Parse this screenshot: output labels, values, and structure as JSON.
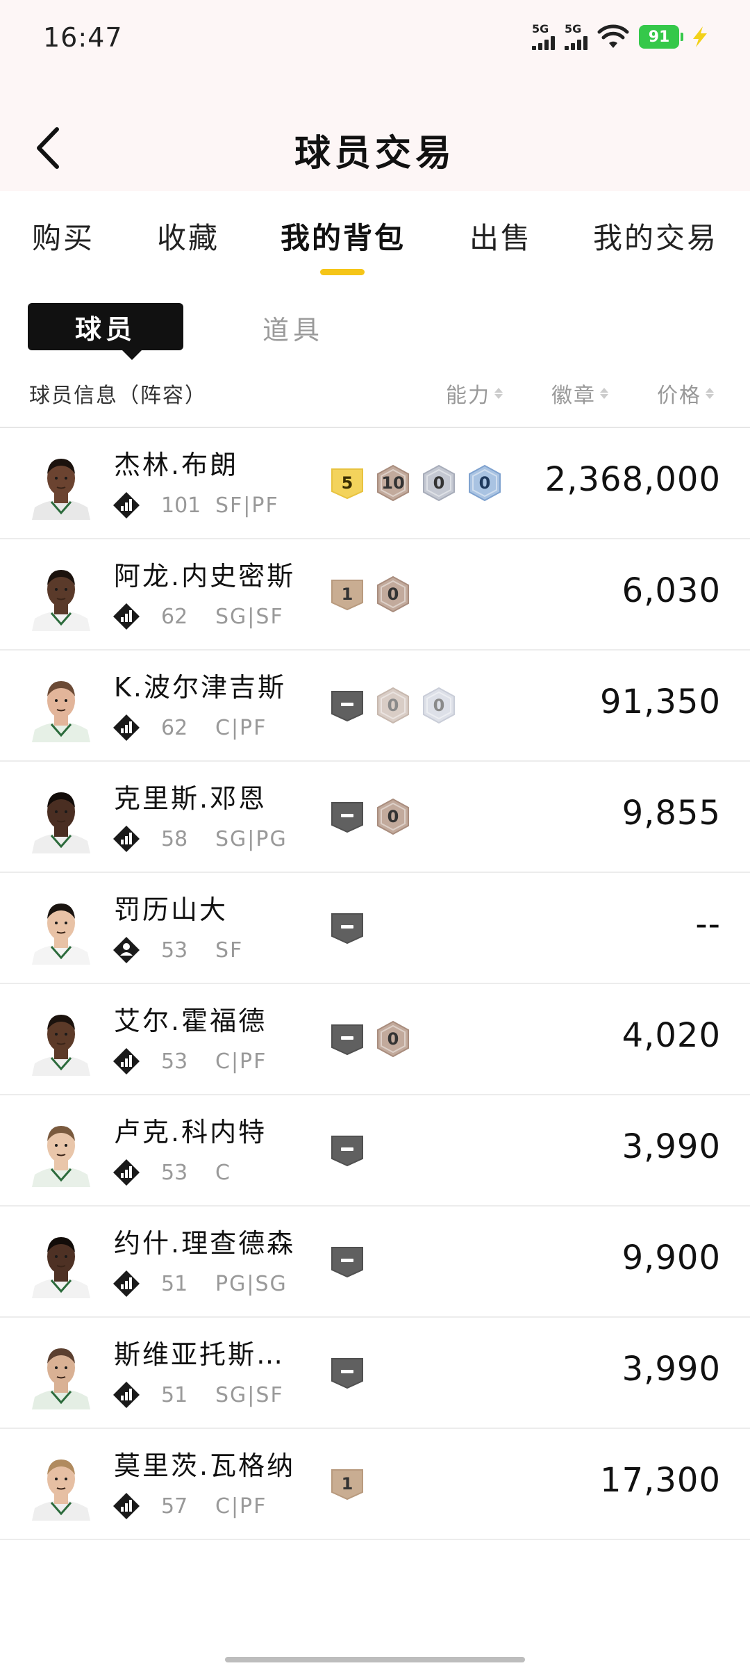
{
  "status_bar": {
    "time": "16:47",
    "signal1": "5G",
    "signal2": "5G",
    "battery": "91"
  },
  "header": {
    "title": "球员交易"
  },
  "tabs": [
    {
      "label": "购买",
      "active": false
    },
    {
      "label": "收藏",
      "active": false
    },
    {
      "label": "我的背包",
      "active": true
    },
    {
      "label": "出售",
      "active": false
    },
    {
      "label": "我的交易",
      "active": false
    }
  ],
  "subtabs": {
    "active": "球员",
    "other": "道具"
  },
  "columns": {
    "info": "球员信息（阵容）",
    "ability": "能力",
    "badge": "徽章",
    "price": "价格"
  },
  "players": [
    {
      "name": "杰林.布朗",
      "rating": "101",
      "position": "SF|PF",
      "price": "2,368,000",
      "rank_icon": "bar-chart-diamond-icon",
      "badges": [
        {
          "type": "gold",
          "value": "5"
        },
        {
          "type": "bronze",
          "value": "10"
        },
        {
          "type": "silver",
          "value": "0"
        },
        {
          "type": "blue",
          "value": "0"
        }
      ]
    },
    {
      "name": "阿龙.内史密斯",
      "rating": "62",
      "position": "SG|SF",
      "price": "6,030",
      "rank_icon": "bar-chart-diamond-icon",
      "badges": [
        {
          "type": "tan",
          "value": "1"
        },
        {
          "type": "bronze",
          "value": "0"
        }
      ]
    },
    {
      "name": "K.波尔津吉斯",
      "rating": "62",
      "position": "C|PF",
      "price": "91,350",
      "rank_icon": "bar-chart-diamond-icon",
      "badges": [
        {
          "type": "dash",
          "value": ""
        },
        {
          "type": "bronze-faded",
          "value": "0"
        },
        {
          "type": "silver-faded",
          "value": "0"
        }
      ]
    },
    {
      "name": "克里斯.邓恩",
      "rating": "58",
      "position": "SG|PG",
      "price": "9,855",
      "rank_icon": "bar-chart-diamond-icon",
      "badges": [
        {
          "type": "dash",
          "value": ""
        },
        {
          "type": "bronze",
          "value": "0"
        }
      ]
    },
    {
      "name": "罚历山大",
      "rating": "53",
      "position": "SF",
      "price": "--",
      "rank_icon": "person-diamond-icon",
      "badges": [
        {
          "type": "dash",
          "value": ""
        }
      ]
    },
    {
      "name": "艾尔.霍福德",
      "rating": "53",
      "position": "C|PF",
      "price": "4,020",
      "rank_icon": "bar-chart-diamond-icon",
      "badges": [
        {
          "type": "dash",
          "value": ""
        },
        {
          "type": "bronze",
          "value": "0"
        }
      ]
    },
    {
      "name": "卢克.科内特",
      "rating": "53",
      "position": "C",
      "price": "3,990",
      "rank_icon": "bar-chart-diamond-icon",
      "badges": [
        {
          "type": "dash",
          "value": ""
        }
      ]
    },
    {
      "name": "约什.理查德森",
      "rating": "51",
      "position": "PG|SG",
      "price": "9,900",
      "rank_icon": "bar-chart-diamond-icon",
      "badges": [
        {
          "type": "dash",
          "value": ""
        }
      ]
    },
    {
      "name": "斯维亚托斯拉…",
      "rating": "51",
      "position": "SG|SF",
      "price": "3,990",
      "rank_icon": "bar-chart-diamond-icon",
      "badges": [
        {
          "type": "dash",
          "value": ""
        }
      ]
    },
    {
      "name": "莫里茨.瓦格纳",
      "rating": "57",
      "position": "C|PF",
      "price": "17,300",
      "rank_icon": "bar-chart-diamond-icon",
      "badges": [
        {
          "type": "tan",
          "value": "1"
        }
      ]
    }
  ],
  "colors": {
    "accent": "#f5c518",
    "gold": "#f3d35c",
    "bronze": "#b9a090",
    "silver": "#b8bcc8",
    "blue": "#8fb0d8",
    "tan": "#c9ad92",
    "dash": "#5e5e5e"
  }
}
